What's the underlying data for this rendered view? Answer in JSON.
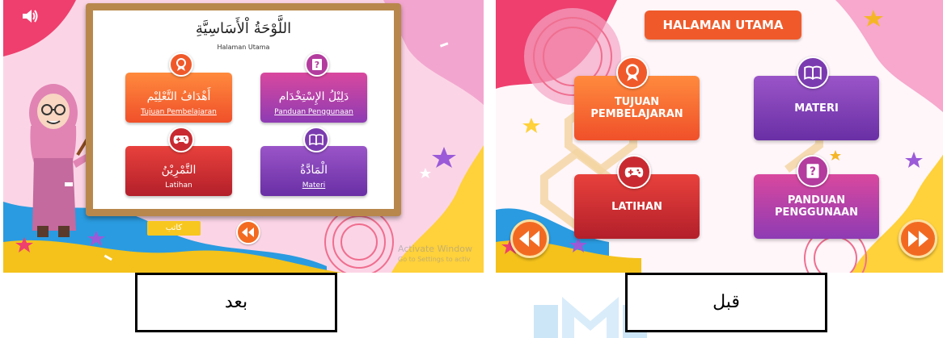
{
  "after_panel": {
    "board_title_ar": "اللَّوْحَةُ اْلأَسَاسِيَّةِ",
    "board_subtitle": "Halaman Utama",
    "buttons": [
      {
        "ar": "أَهْدَافُ التَّعْلِيْم",
        "label": "Tujuan Pembelajaran",
        "icon": "award-ribbon-icon"
      },
      {
        "ar": "دَلِيْلُ الإِسْتِخْدَام",
        "label": "Panduan Penggunaan",
        "icon": "question-book-icon"
      },
      {
        "ar": "التَّمْرِيْنُ",
        "label": "Latihan",
        "icon": "gamepad-icon"
      },
      {
        "ar": "الْمَادَّةُ",
        "label": "Materi",
        "icon": "open-book-icon"
      }
    ],
    "author_label": "كاتب",
    "watermark_line1": "Activate Window",
    "watermark_line2": "Go to Settings to activ"
  },
  "before_panel": {
    "title": "HALAMAN UTAMA",
    "buttons": [
      {
        "line1": "TUJUAN",
        "line2": "PEMBELAJARAN",
        "icon": "award-ribbon-icon"
      },
      {
        "line1": "MATERI",
        "line2": "",
        "icon": "open-book-icon"
      },
      {
        "line1": "LATIHAN",
        "line2": "",
        "icon": "gamepad-icon"
      },
      {
        "line1": "PANDUAN",
        "line2": "PENGGUNAAN",
        "icon": "question-book-icon"
      }
    ]
  },
  "captions": {
    "after": "بعد",
    "before": "قبل"
  },
  "colors": {
    "orange": "#f05a2a",
    "magenta": "#c0409f",
    "red": "#d0282f",
    "purple": "#7b3bb0",
    "board_frame": "#b8874c"
  }
}
